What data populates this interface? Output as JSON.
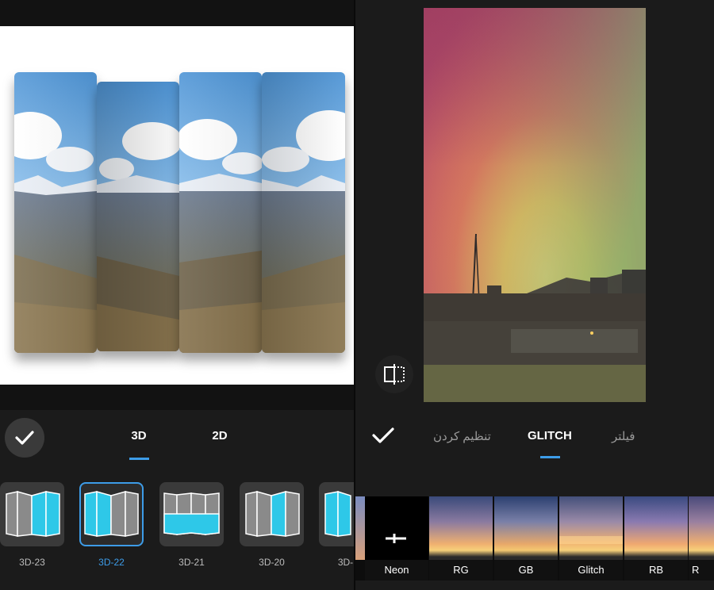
{
  "left_panel": {
    "tabs": [
      {
        "label": "3D",
        "active": true
      },
      {
        "label": "2D",
        "active": false
      }
    ],
    "templates": [
      {
        "label": "3D-23",
        "selected": false
      },
      {
        "label": "3D-22",
        "selected": true
      },
      {
        "label": "3D-21",
        "selected": false
      },
      {
        "label": "3D-20",
        "selected": false
      },
      {
        "label": "3D-",
        "selected": false
      }
    ],
    "accent": "#3d9ce8",
    "template_fill": "#2ec8e8"
  },
  "right_panel": {
    "tabs": [
      {
        "label": "تنظیم کردن",
        "active": false
      },
      {
        "label": "GLITCH",
        "active": true
      },
      {
        "label": "فیلتر",
        "active": false
      }
    ],
    "filters": [
      "Neon",
      "RG",
      "GB",
      "Glitch",
      "RB",
      "R"
    ]
  },
  "icons": {
    "apply_left": "check-icon",
    "apply_right": "check-icon",
    "compare": "compare-icon"
  }
}
